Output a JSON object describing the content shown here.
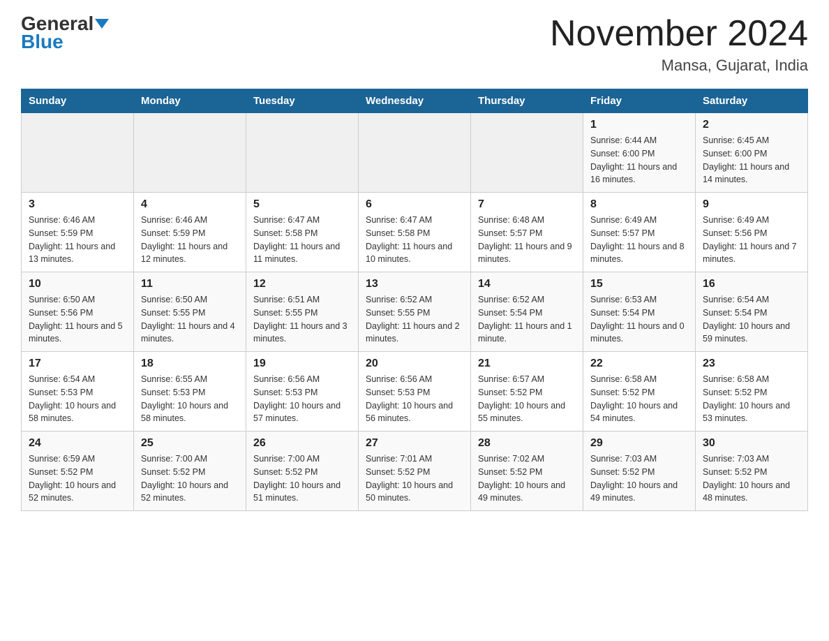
{
  "header": {
    "logo_general": "General",
    "logo_blue": "Blue",
    "month_title": "November 2024",
    "location": "Mansa, Gujarat, India"
  },
  "days_of_week": [
    "Sunday",
    "Monday",
    "Tuesday",
    "Wednesday",
    "Thursday",
    "Friday",
    "Saturday"
  ],
  "weeks": [
    {
      "cells": [
        {
          "day": null,
          "info": null
        },
        {
          "day": null,
          "info": null
        },
        {
          "day": null,
          "info": null
        },
        {
          "day": null,
          "info": null
        },
        {
          "day": null,
          "info": null
        },
        {
          "day": "1",
          "info": "Sunrise: 6:44 AM\nSunset: 6:00 PM\nDaylight: 11 hours and 16 minutes."
        },
        {
          "day": "2",
          "info": "Sunrise: 6:45 AM\nSunset: 6:00 PM\nDaylight: 11 hours and 14 minutes."
        }
      ]
    },
    {
      "cells": [
        {
          "day": "3",
          "info": "Sunrise: 6:46 AM\nSunset: 5:59 PM\nDaylight: 11 hours and 13 minutes."
        },
        {
          "day": "4",
          "info": "Sunrise: 6:46 AM\nSunset: 5:59 PM\nDaylight: 11 hours and 12 minutes."
        },
        {
          "day": "5",
          "info": "Sunrise: 6:47 AM\nSunset: 5:58 PM\nDaylight: 11 hours and 11 minutes."
        },
        {
          "day": "6",
          "info": "Sunrise: 6:47 AM\nSunset: 5:58 PM\nDaylight: 11 hours and 10 minutes."
        },
        {
          "day": "7",
          "info": "Sunrise: 6:48 AM\nSunset: 5:57 PM\nDaylight: 11 hours and 9 minutes."
        },
        {
          "day": "8",
          "info": "Sunrise: 6:49 AM\nSunset: 5:57 PM\nDaylight: 11 hours and 8 minutes."
        },
        {
          "day": "9",
          "info": "Sunrise: 6:49 AM\nSunset: 5:56 PM\nDaylight: 11 hours and 7 minutes."
        }
      ]
    },
    {
      "cells": [
        {
          "day": "10",
          "info": "Sunrise: 6:50 AM\nSunset: 5:56 PM\nDaylight: 11 hours and 5 minutes."
        },
        {
          "day": "11",
          "info": "Sunrise: 6:50 AM\nSunset: 5:55 PM\nDaylight: 11 hours and 4 minutes."
        },
        {
          "day": "12",
          "info": "Sunrise: 6:51 AM\nSunset: 5:55 PM\nDaylight: 11 hours and 3 minutes."
        },
        {
          "day": "13",
          "info": "Sunrise: 6:52 AM\nSunset: 5:55 PM\nDaylight: 11 hours and 2 minutes."
        },
        {
          "day": "14",
          "info": "Sunrise: 6:52 AM\nSunset: 5:54 PM\nDaylight: 11 hours and 1 minute."
        },
        {
          "day": "15",
          "info": "Sunrise: 6:53 AM\nSunset: 5:54 PM\nDaylight: 11 hours and 0 minutes."
        },
        {
          "day": "16",
          "info": "Sunrise: 6:54 AM\nSunset: 5:54 PM\nDaylight: 10 hours and 59 minutes."
        }
      ]
    },
    {
      "cells": [
        {
          "day": "17",
          "info": "Sunrise: 6:54 AM\nSunset: 5:53 PM\nDaylight: 10 hours and 58 minutes."
        },
        {
          "day": "18",
          "info": "Sunrise: 6:55 AM\nSunset: 5:53 PM\nDaylight: 10 hours and 58 minutes."
        },
        {
          "day": "19",
          "info": "Sunrise: 6:56 AM\nSunset: 5:53 PM\nDaylight: 10 hours and 57 minutes."
        },
        {
          "day": "20",
          "info": "Sunrise: 6:56 AM\nSunset: 5:53 PM\nDaylight: 10 hours and 56 minutes."
        },
        {
          "day": "21",
          "info": "Sunrise: 6:57 AM\nSunset: 5:52 PM\nDaylight: 10 hours and 55 minutes."
        },
        {
          "day": "22",
          "info": "Sunrise: 6:58 AM\nSunset: 5:52 PM\nDaylight: 10 hours and 54 minutes."
        },
        {
          "day": "23",
          "info": "Sunrise: 6:58 AM\nSunset: 5:52 PM\nDaylight: 10 hours and 53 minutes."
        }
      ]
    },
    {
      "cells": [
        {
          "day": "24",
          "info": "Sunrise: 6:59 AM\nSunset: 5:52 PM\nDaylight: 10 hours and 52 minutes."
        },
        {
          "day": "25",
          "info": "Sunrise: 7:00 AM\nSunset: 5:52 PM\nDaylight: 10 hours and 52 minutes."
        },
        {
          "day": "26",
          "info": "Sunrise: 7:00 AM\nSunset: 5:52 PM\nDaylight: 10 hours and 51 minutes."
        },
        {
          "day": "27",
          "info": "Sunrise: 7:01 AM\nSunset: 5:52 PM\nDaylight: 10 hours and 50 minutes."
        },
        {
          "day": "28",
          "info": "Sunrise: 7:02 AM\nSunset: 5:52 PM\nDaylight: 10 hours and 49 minutes."
        },
        {
          "day": "29",
          "info": "Sunrise: 7:03 AM\nSunset: 5:52 PM\nDaylight: 10 hours and 49 minutes."
        },
        {
          "day": "30",
          "info": "Sunrise: 7:03 AM\nSunset: 5:52 PM\nDaylight: 10 hours and 48 minutes."
        }
      ]
    }
  ]
}
